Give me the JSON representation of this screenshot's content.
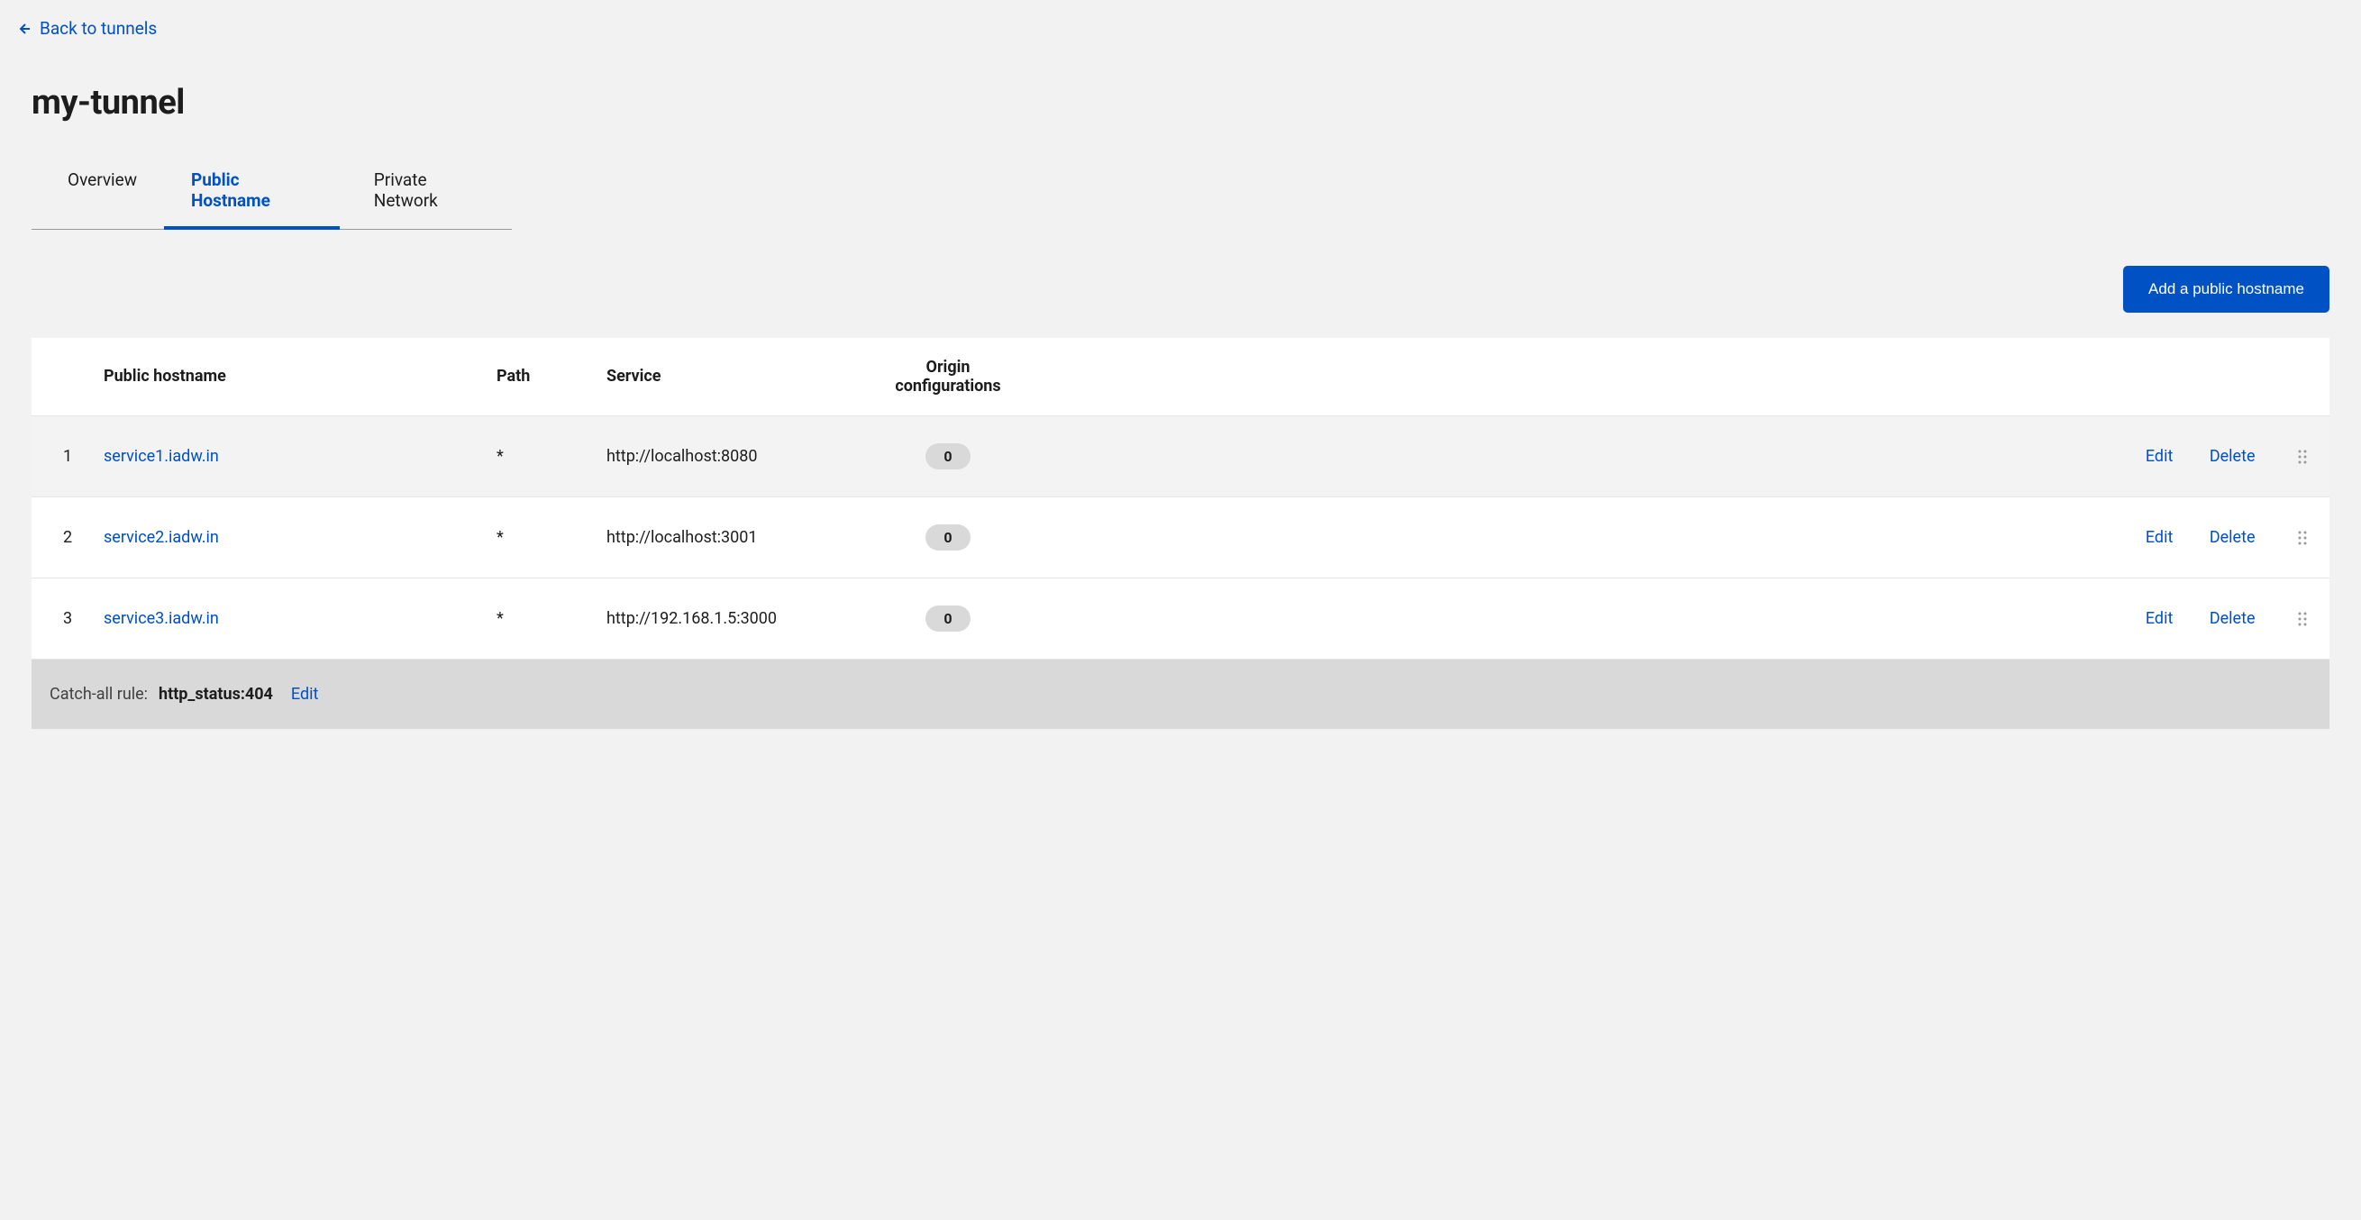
{
  "back_link": {
    "label": "Back to tunnels"
  },
  "page_title": "my-tunnel",
  "tabs": [
    {
      "label": "Overview",
      "active": false
    },
    {
      "label": "Public Hostname",
      "active": true
    },
    {
      "label": "Private Network",
      "active": false
    }
  ],
  "add_button": {
    "label": "Add a public hostname"
  },
  "table": {
    "headers": {
      "hostname": "Public hostname",
      "path": "Path",
      "service": "Service",
      "origin": "Origin configurations"
    },
    "rows": [
      {
        "index": "1",
        "hostname": "service1.iadw.in",
        "path": "*",
        "service": "http://localhost:8080",
        "origin_count": "0",
        "edit_label": "Edit",
        "delete_label": "Delete",
        "highlighted": true
      },
      {
        "index": "2",
        "hostname": "service2.iadw.in",
        "path": "*",
        "service": "http://localhost:3001",
        "origin_count": "0",
        "edit_label": "Edit",
        "delete_label": "Delete",
        "highlighted": false
      },
      {
        "index": "3",
        "hostname": "service3.iadw.in",
        "path": "*",
        "service": "http://192.168.1.5:3000",
        "origin_count": "0",
        "edit_label": "Edit",
        "delete_label": "Delete",
        "highlighted": false
      }
    ]
  },
  "catch_all": {
    "label": "Catch-all rule:",
    "value": "http_status:404",
    "edit_label": "Edit"
  }
}
